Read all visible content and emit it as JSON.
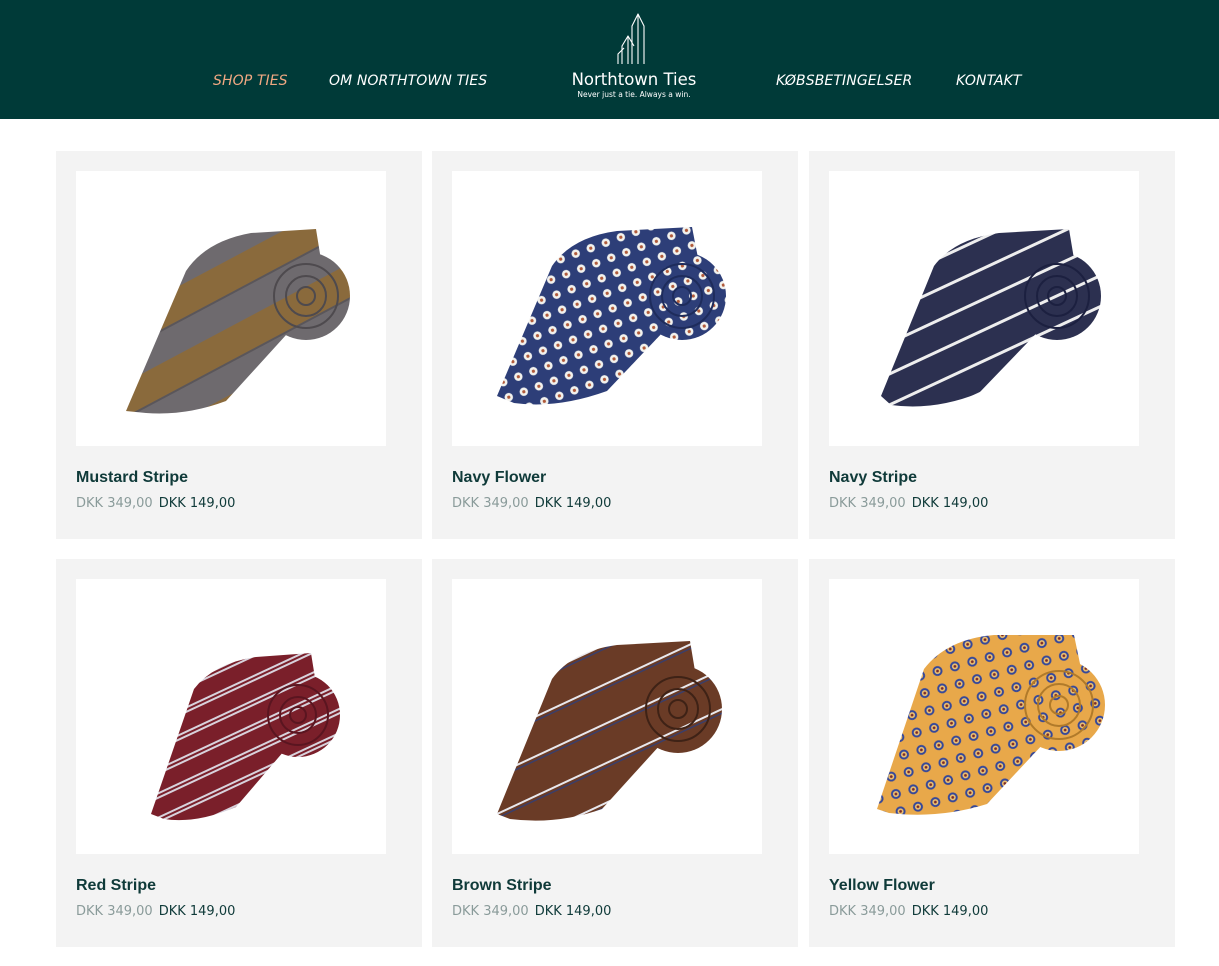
{
  "header": {
    "nav": {
      "shop": "SHOP TIES",
      "about": "OM NORTHTOWN TIES",
      "terms": "KØBSBETINGELSER",
      "contact": "KONTAKT"
    },
    "logo": {
      "name": "Northtown Ties",
      "tagline": "Never just a tie. Always a win."
    },
    "colors": {
      "background": "#003a38",
      "active_nav": "#f0a882"
    }
  },
  "products": [
    {
      "name": "Mustard Stripe",
      "old_price": "DKK 349,00",
      "new_price": "DKK 149,00",
      "image": "tie-mustard-stripe"
    },
    {
      "name": "Navy Flower",
      "old_price": "DKK 349,00",
      "new_price": "DKK 149,00",
      "image": "tie-navy-flower"
    },
    {
      "name": "Navy Stripe",
      "old_price": "DKK 349,00",
      "new_price": "DKK 149,00",
      "image": "tie-navy-stripe"
    },
    {
      "name": "Red Stripe",
      "old_price": "DKK 349,00",
      "new_price": "DKK 149,00",
      "image": "tie-red-stripe"
    },
    {
      "name": "Brown Stripe",
      "old_price": "DKK 349,00",
      "new_price": "DKK 149,00",
      "image": "tie-brown-stripe"
    },
    {
      "name": "Yellow Flower",
      "old_price": "DKK 349,00",
      "new_price": "DKK 149,00",
      "image": "tie-yellow-flower"
    }
  ]
}
